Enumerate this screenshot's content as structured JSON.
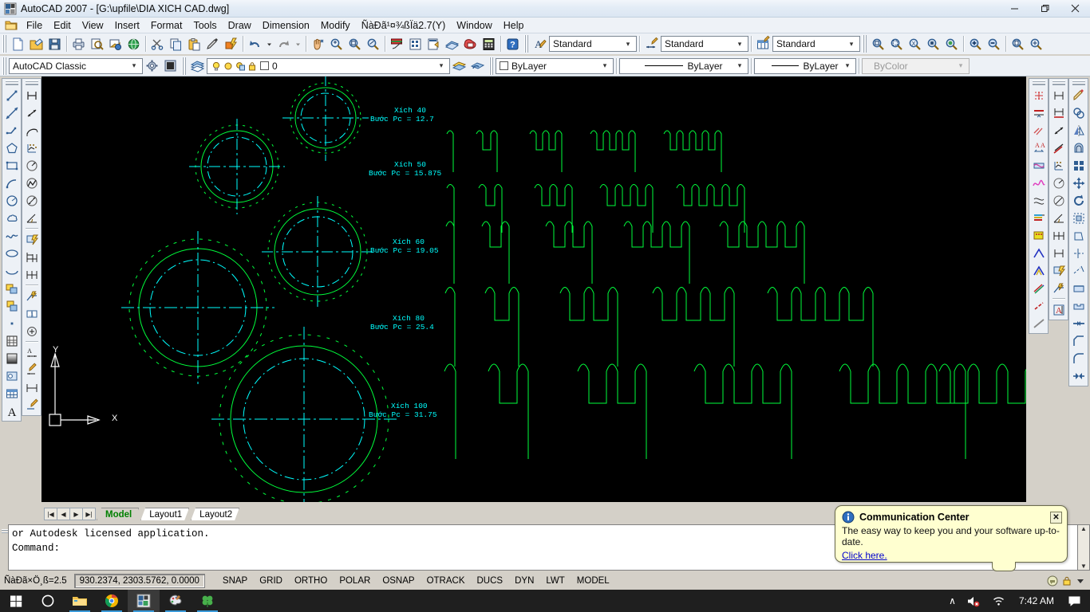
{
  "window": {
    "title": "AutoCAD 2007 - [G:\\upfile\\DIA XICH CAD.dwg]",
    "app_icon": "autocad-icon",
    "minimize_label": "Minimize",
    "maximize_label": "Restore",
    "close_label": "Close"
  },
  "menubar": {
    "items": [
      {
        "label": "File"
      },
      {
        "label": "Edit"
      },
      {
        "label": "View"
      },
      {
        "label": "Insert"
      },
      {
        "label": "Format"
      },
      {
        "label": "Tools"
      },
      {
        "label": "Draw"
      },
      {
        "label": "Dimension"
      },
      {
        "label": "Modify"
      },
      {
        "label": "ÑàÐã¹¤¾ßÏä2.7(Y)"
      },
      {
        "label": "Window"
      },
      {
        "label": "Help"
      }
    ]
  },
  "toolbar_standard": {
    "buttons": [
      {
        "name": "new-icon"
      },
      {
        "name": "open-icon"
      },
      {
        "name": "save-icon"
      },
      {
        "name": "plot-icon"
      },
      {
        "name": "plot-preview-icon"
      },
      {
        "name": "publish-icon"
      },
      {
        "name": "publish-web-icon"
      },
      {
        "name": "cut-icon"
      },
      {
        "name": "copy-icon"
      },
      {
        "name": "paste-icon"
      },
      {
        "name": "match-properties-icon"
      },
      {
        "name": "block-editor-icon"
      },
      {
        "name": "undo-icon"
      },
      {
        "name": "undo-dropdown-icon"
      },
      {
        "name": "redo-icon"
      },
      {
        "name": "redo-dropdown-icon"
      },
      {
        "name": "pan-realtime-icon"
      },
      {
        "name": "zoom-realtime-icon"
      },
      {
        "name": "zoom-window-icon"
      },
      {
        "name": "zoom-previous-icon"
      },
      {
        "name": "properties-icon"
      },
      {
        "name": "designcenter-icon"
      },
      {
        "name": "tool-palettes-icon"
      },
      {
        "name": "sheet-set-icon"
      },
      {
        "name": "markup-set-icon"
      },
      {
        "name": "quickcalc-icon"
      },
      {
        "name": "help-icon"
      }
    ]
  },
  "toolbar_styles": {
    "text_style": {
      "name": "text-style-combo",
      "value": "Standard",
      "icon": "text-style-icon"
    },
    "dim_style": {
      "name": "dimension-style-combo",
      "value": "Standard",
      "icon": "dimension-style-icon"
    },
    "table_style": {
      "name": "table-style-combo",
      "value": "Standard",
      "icon": "table-style-icon"
    }
  },
  "toolbar_zoom": {
    "buttons": [
      {
        "name": "zoom-window-icon"
      },
      {
        "name": "zoom-dynamic-icon"
      },
      {
        "name": "zoom-scale-icon"
      },
      {
        "name": "zoom-center-icon"
      },
      {
        "name": "zoom-object-icon"
      },
      {
        "name": "zoom-in-icon"
      },
      {
        "name": "zoom-out-icon"
      },
      {
        "name": "zoom-all-icon"
      },
      {
        "name": "zoom-extents-icon"
      }
    ]
  },
  "toolbar_workspace": {
    "workspace": {
      "name": "workspace-combo",
      "value": "AutoCAD Classic"
    },
    "settings_icon": "workspace-settings-icon",
    "my_workspace_icon": "my-workspace-icon"
  },
  "toolbar_layers": {
    "layer_manager_icon": "layer-properties-manager-icon",
    "layer": {
      "name": "layer-combo",
      "value": "0",
      "state_icons": [
        "lightbulb-on-icon",
        "sun-freeze-icon",
        "freeze-viewport-icon",
        "lock-icon"
      ]
    },
    "make_current_icon": "make-object-layer-current-icon",
    "layer_previous_icon": "layer-previous-icon"
  },
  "toolbar_properties": {
    "color": {
      "name": "color-combo",
      "value": "ByLayer",
      "swatch": "#ffffff"
    },
    "linetype": {
      "name": "linetype-combo",
      "value": "ByLayer"
    },
    "lineweight": {
      "name": "lineweight-combo",
      "value": "ByLayer"
    },
    "plotstyle": {
      "name": "plotstyle-combo",
      "value": "ByColor",
      "disabled": true
    }
  },
  "toolbars_left": {
    "draw": {
      "title": "Draw",
      "buttons": [
        "line-icon",
        "construction-line-icon",
        "polyline-icon",
        "polygon-icon",
        "rectangle-icon",
        "arc-icon",
        "circle-icon",
        "revision-cloud-icon",
        "spline-icon",
        "ellipse-icon",
        "ellipse-arc-icon",
        "insert-block-icon",
        "make-block-icon",
        "point-icon",
        "hatch-icon",
        "gradient-icon",
        "region-icon",
        "table-icon",
        "multiline-text-icon"
      ]
    },
    "dimension": {
      "title": "Dimension",
      "buttons": [
        "linear-dimension-icon",
        "aligned-dimension-icon",
        "arc-length-dimension-icon",
        "ordinate-dimension-icon",
        "radius-dimension-icon",
        "jogged-dimension-icon",
        "diameter-dimension-icon",
        "angular-dimension-icon",
        "quick-dimension-icon",
        "baseline-dimension-icon",
        "continue-dimension-icon",
        "quick-leader-icon",
        "tolerance-icon",
        "center-mark-icon",
        "dimension-edit-icon",
        "dimension-text-edit-icon",
        "dimension-update-icon",
        "dimension-style-icon"
      ]
    }
  },
  "toolbars_right": {
    "modify2": {
      "title": "Modify II",
      "buttons": [
        "edit-hatch-icon",
        "edit-polyline-icon",
        "edit-spline-icon",
        "edit-attribute-icon",
        "edit-multiline-icon",
        "draw-order-icon",
        "hatch-edit-icon",
        "text-to-front-icon",
        "solid-editing-icon",
        "union-icon",
        "subtract-icon",
        "intersect-icon",
        "slice-icon",
        "section-icon"
      ]
    },
    "dimension2": {
      "title": "Dimension",
      "buttons": [
        "linear-dimension-icon",
        "baseline-dimension-icon",
        "aligned-dimension-icon",
        "continue-dimension-icon",
        "ordinate-dimension-icon",
        "radius-dimension-icon",
        "diameter-dimension-icon",
        "angular-dimension-icon",
        "quick-dimension-icon",
        "jogged-dimension-icon",
        "quick-leader-icon",
        "tolerance-icon",
        "dimension-text-edit-icon"
      ]
    },
    "modify": {
      "title": "Modify",
      "buttons": [
        "erase-icon",
        "copy-icon",
        "mirror-icon",
        "offset-icon",
        "array-icon",
        "move-icon",
        "rotate-icon",
        "scale-icon",
        "stretch-icon",
        "trim-icon",
        "extend-icon",
        "break-at-point-icon",
        "break-icon",
        "join-icon",
        "chamfer-icon",
        "fillet-icon",
        "explode-icon"
      ]
    }
  },
  "drawing": {
    "ucs": {
      "x_label": "X",
      "y_label": "Y"
    },
    "labels": [
      {
        "title": "Xích 40",
        "subtitle": "Bước Pc = 12.7"
      },
      {
        "title": "Xích 50",
        "subtitle": "Bước Pc = 15.875"
      },
      {
        "title": "Xích 60",
        "subtitle": "Bước Pc = 19.05"
      },
      {
        "title": "Xích 80",
        "subtitle": "Bước Pc = 25.4"
      },
      {
        "title": "Xích 100",
        "subtitle": "Bước Pc = 31.75"
      }
    ],
    "colors": {
      "geometry": "#00ff3c",
      "text": "#00ffff",
      "centerline": "#00ffff",
      "ucs": "#ffffff"
    }
  },
  "tabs": {
    "nav": [
      {
        "label": "|◀"
      },
      {
        "label": "◀"
      },
      {
        "label": "▶"
      },
      {
        "label": "▶|"
      }
    ],
    "items": [
      {
        "label": "Model",
        "active": true
      },
      {
        "label": "Layout1",
        "active": false
      },
      {
        "label": "Layout2",
        "active": false
      }
    ]
  },
  "command_line": {
    "history": "or Autodesk licensed application.",
    "prompt": "Command:"
  },
  "status_bar": {
    "left_label": "ÑàÐã×Ö¸ß=2.5",
    "coordinates": "930.2374,  2303.5762, 0.0000",
    "toggles": [
      {
        "label": "SNAP",
        "pressed": false
      },
      {
        "label": "GRID",
        "pressed": false
      },
      {
        "label": "ORTHO",
        "pressed": false
      },
      {
        "label": "POLAR",
        "pressed": false
      },
      {
        "label": "OSNAP",
        "pressed": false
      },
      {
        "label": "OTRACK",
        "pressed": false
      },
      {
        "label": "DUCS",
        "pressed": false
      },
      {
        "label": "DYN",
        "pressed": false
      },
      {
        "label": "LWT",
        "pressed": false
      },
      {
        "label": "MODEL",
        "pressed": false
      }
    ]
  },
  "balloon": {
    "icon": "info-icon",
    "title": "Communication Center",
    "body": "The easy way to keep you and your software up-to-date.",
    "link": "Click here.",
    "close_label": "✕"
  },
  "taskbar": {
    "items": [
      {
        "name": "start-button-icon",
        "active": false,
        "running": false
      },
      {
        "name": "cortana-search-icon",
        "active": false,
        "running": false
      },
      {
        "name": "file-explorer-icon",
        "active": false,
        "running": true
      },
      {
        "name": "chrome-icon",
        "active": false,
        "running": true
      },
      {
        "name": "autocad-icon",
        "active": true,
        "running": true
      },
      {
        "name": "paint-icon",
        "active": false,
        "running": true
      },
      {
        "name": "clover-icon",
        "active": false,
        "running": true
      }
    ],
    "tray": [
      {
        "name": "show-hidden-icons-icon",
        "glyph": "∧"
      },
      {
        "name": "volume-muted-icon",
        "glyph": ""
      },
      {
        "name": "wifi-icon",
        "glyph": ""
      }
    ],
    "clock": "7:42 AM",
    "action_center_icon": "action-center-icon"
  }
}
